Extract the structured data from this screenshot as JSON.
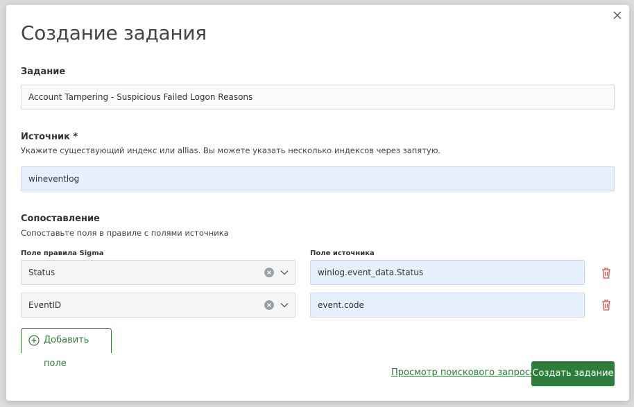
{
  "dialog": {
    "title": "Создание задания",
    "close_icon": "close-icon"
  },
  "task": {
    "label": "Задание",
    "value": "Account Tampering - Suspicious Failed Logon Reasons"
  },
  "source": {
    "label": "Источник *",
    "help": "Укажите существующий индекс или allias. Вы можете указать несколько индексов через запятую.",
    "value": "wineventlog"
  },
  "mapping": {
    "label": "Сопоставление",
    "help": "Сопоставьте поля в правиле с полями источника",
    "rule_column_label": "Поле правила Sigma",
    "source_column_label": "Поле источника",
    "rows": [
      {
        "rule_field": "Status",
        "source_field": "winlog.event_data.Status"
      },
      {
        "rule_field": "EventID",
        "source_field": "event.code"
      }
    ],
    "add_label": "Добавить поле"
  },
  "footer": {
    "preview_link": "Просмотр поискового запроса",
    "submit_label": "Создать задание"
  },
  "colors": {
    "primary": "#2e7d3a",
    "danger": "#d9534f",
    "input_blue": "#e6effc"
  }
}
